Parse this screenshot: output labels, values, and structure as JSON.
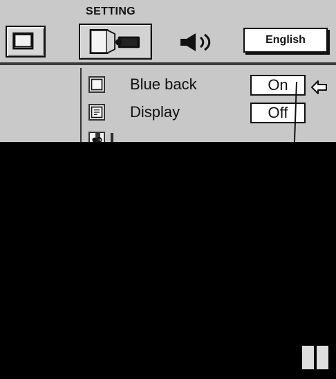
{
  "settings_menu": {
    "title": "SETTING",
    "language_button_label": "English",
    "items": [
      {
        "icon": "blue-back-icon",
        "label": "Blue back",
        "value": "On"
      },
      {
        "icon": "display-icon",
        "label": "Display",
        "value": "Off"
      }
    ]
  },
  "icons": {
    "left_menu_icon": "screen-frame-icon",
    "active_menu_icon": "projector-settings-icon",
    "audio_icon": "speaker-icon",
    "pointer_icon": "left-arrow-icon",
    "corner_icon": "page-tabs-icon"
  },
  "colors": {
    "panel": "#c9c9c9",
    "menu_panel": "#c8c8c8",
    "background": "#000000",
    "text": "#111111",
    "highlight_box": "#ffffff"
  }
}
